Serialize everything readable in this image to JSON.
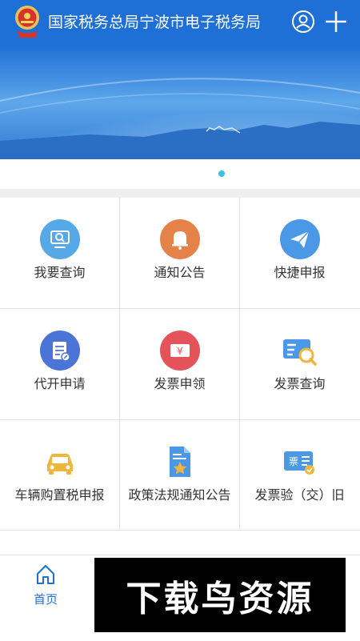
{
  "header": {
    "title": "国家税务总局宁波市电子税务局",
    "user_icon": "user-circle-icon",
    "add_icon": "plus-icon",
    "emblem_icon": "tax-emblem-icon",
    "bg_color": "#1e6fd6"
  },
  "banner": {
    "slides": 2,
    "active_slide": 2
  },
  "grid": {
    "items": [
      {
        "label": "我要查询",
        "icon": "search-monitor-icon",
        "color": "#56a8e6"
      },
      {
        "label": "通知公告",
        "icon": "bell-icon",
        "color": "#e5824a"
      },
      {
        "label": "快捷申报",
        "icon": "paper-plane-icon",
        "color": "#4a98e6"
      },
      {
        "label": "代开申请",
        "icon": "document-edit-icon",
        "color": "#4a74d6"
      },
      {
        "label": "发票申领",
        "icon": "yuan-ticket-icon",
        "color": "#e5535a"
      },
      {
        "label": "发票查询",
        "icon": "invoice-search-icon",
        "color": "#4a98e6"
      },
      {
        "label": "车辆购置税申报",
        "icon": "car-icon",
        "color": "#f0b63c"
      },
      {
        "label": "政策法规通知公告",
        "icon": "policy-document-icon",
        "color": "#4a98e6"
      },
      {
        "label": "发票验（交）旧",
        "icon": "invoice-verify-icon",
        "color": "#4a98e6"
      }
    ]
  },
  "tabbar": {
    "home_label": "首页",
    "home_icon": "home-icon"
  },
  "watermark": {
    "text": "下载鸟资源"
  }
}
